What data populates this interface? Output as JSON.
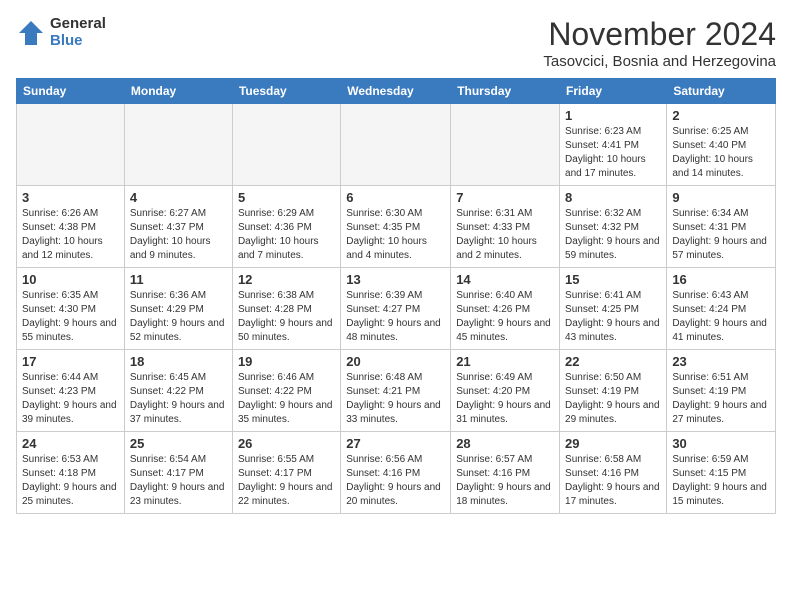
{
  "logo": {
    "general": "General",
    "blue": "Blue"
  },
  "title": "November 2024",
  "location": "Tasovcici, Bosnia and Herzegovina",
  "headers": [
    "Sunday",
    "Monday",
    "Tuesday",
    "Wednesday",
    "Thursday",
    "Friday",
    "Saturday"
  ],
  "weeks": [
    [
      {
        "day": "",
        "detail": ""
      },
      {
        "day": "",
        "detail": ""
      },
      {
        "day": "",
        "detail": ""
      },
      {
        "day": "",
        "detail": ""
      },
      {
        "day": "",
        "detail": ""
      },
      {
        "day": "1",
        "detail": "Sunrise: 6:23 AM\nSunset: 4:41 PM\nDaylight: 10 hours and 17 minutes."
      },
      {
        "day": "2",
        "detail": "Sunrise: 6:25 AM\nSunset: 4:40 PM\nDaylight: 10 hours and 14 minutes."
      }
    ],
    [
      {
        "day": "3",
        "detail": "Sunrise: 6:26 AM\nSunset: 4:38 PM\nDaylight: 10 hours and 12 minutes."
      },
      {
        "day": "4",
        "detail": "Sunrise: 6:27 AM\nSunset: 4:37 PM\nDaylight: 10 hours and 9 minutes."
      },
      {
        "day": "5",
        "detail": "Sunrise: 6:29 AM\nSunset: 4:36 PM\nDaylight: 10 hours and 7 minutes."
      },
      {
        "day": "6",
        "detail": "Sunrise: 6:30 AM\nSunset: 4:35 PM\nDaylight: 10 hours and 4 minutes."
      },
      {
        "day": "7",
        "detail": "Sunrise: 6:31 AM\nSunset: 4:33 PM\nDaylight: 10 hours and 2 minutes."
      },
      {
        "day": "8",
        "detail": "Sunrise: 6:32 AM\nSunset: 4:32 PM\nDaylight: 9 hours and 59 minutes."
      },
      {
        "day": "9",
        "detail": "Sunrise: 6:34 AM\nSunset: 4:31 PM\nDaylight: 9 hours and 57 minutes."
      }
    ],
    [
      {
        "day": "10",
        "detail": "Sunrise: 6:35 AM\nSunset: 4:30 PM\nDaylight: 9 hours and 55 minutes."
      },
      {
        "day": "11",
        "detail": "Sunrise: 6:36 AM\nSunset: 4:29 PM\nDaylight: 9 hours and 52 minutes."
      },
      {
        "day": "12",
        "detail": "Sunrise: 6:38 AM\nSunset: 4:28 PM\nDaylight: 9 hours and 50 minutes."
      },
      {
        "day": "13",
        "detail": "Sunrise: 6:39 AM\nSunset: 4:27 PM\nDaylight: 9 hours and 48 minutes."
      },
      {
        "day": "14",
        "detail": "Sunrise: 6:40 AM\nSunset: 4:26 PM\nDaylight: 9 hours and 45 minutes."
      },
      {
        "day": "15",
        "detail": "Sunrise: 6:41 AM\nSunset: 4:25 PM\nDaylight: 9 hours and 43 minutes."
      },
      {
        "day": "16",
        "detail": "Sunrise: 6:43 AM\nSunset: 4:24 PM\nDaylight: 9 hours and 41 minutes."
      }
    ],
    [
      {
        "day": "17",
        "detail": "Sunrise: 6:44 AM\nSunset: 4:23 PM\nDaylight: 9 hours and 39 minutes."
      },
      {
        "day": "18",
        "detail": "Sunrise: 6:45 AM\nSunset: 4:22 PM\nDaylight: 9 hours and 37 minutes."
      },
      {
        "day": "19",
        "detail": "Sunrise: 6:46 AM\nSunset: 4:22 PM\nDaylight: 9 hours and 35 minutes."
      },
      {
        "day": "20",
        "detail": "Sunrise: 6:48 AM\nSunset: 4:21 PM\nDaylight: 9 hours and 33 minutes."
      },
      {
        "day": "21",
        "detail": "Sunrise: 6:49 AM\nSunset: 4:20 PM\nDaylight: 9 hours and 31 minutes."
      },
      {
        "day": "22",
        "detail": "Sunrise: 6:50 AM\nSunset: 4:19 PM\nDaylight: 9 hours and 29 minutes."
      },
      {
        "day": "23",
        "detail": "Sunrise: 6:51 AM\nSunset: 4:19 PM\nDaylight: 9 hours and 27 minutes."
      }
    ],
    [
      {
        "day": "24",
        "detail": "Sunrise: 6:53 AM\nSunset: 4:18 PM\nDaylight: 9 hours and 25 minutes."
      },
      {
        "day": "25",
        "detail": "Sunrise: 6:54 AM\nSunset: 4:17 PM\nDaylight: 9 hours and 23 minutes."
      },
      {
        "day": "26",
        "detail": "Sunrise: 6:55 AM\nSunset: 4:17 PM\nDaylight: 9 hours and 22 minutes."
      },
      {
        "day": "27",
        "detail": "Sunrise: 6:56 AM\nSunset: 4:16 PM\nDaylight: 9 hours and 20 minutes."
      },
      {
        "day": "28",
        "detail": "Sunrise: 6:57 AM\nSunset: 4:16 PM\nDaylight: 9 hours and 18 minutes."
      },
      {
        "day": "29",
        "detail": "Sunrise: 6:58 AM\nSunset: 4:16 PM\nDaylight: 9 hours and 17 minutes."
      },
      {
        "day": "30",
        "detail": "Sunrise: 6:59 AM\nSunset: 4:15 PM\nDaylight: 9 hours and 15 minutes."
      }
    ]
  ]
}
